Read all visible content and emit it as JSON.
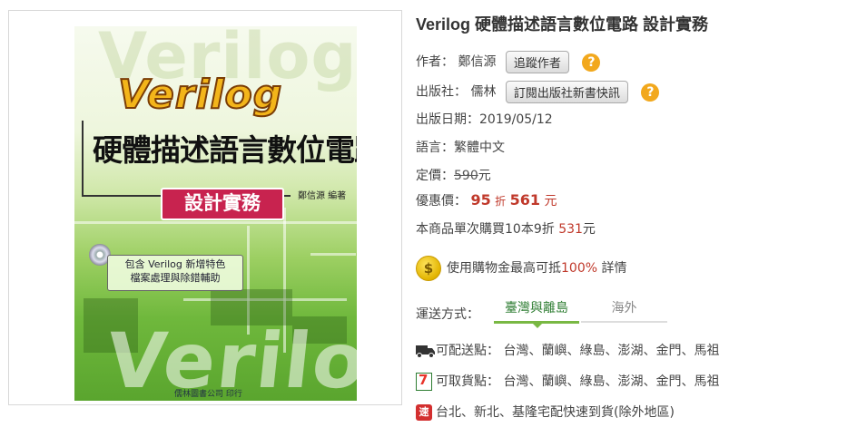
{
  "cover": {
    "ghost_top": "Verilog",
    "verilog": "Verilog",
    "title": "硬體描述語言數位電路",
    "subtitle": "設計實務",
    "author": "鄭信源 編著",
    "cd_line1": "包含 Verilog 新增特色",
    "cd_line2": "檔案處理與除錯輔助",
    "ghost_bottom": "Verilog",
    "publisher": "儒林圖書公司 印行"
  },
  "book": {
    "title": "Verilog 硬體描述語言數位電路 設計實務",
    "author_label": "作者：",
    "author": "鄭信源",
    "follow_author_button": "追蹤作者",
    "publisher_label": "出版社：",
    "publisher": "儒林",
    "subscribe_button": "訂閱出版社新書快訊",
    "date_label": "出版日期：",
    "date": "2019/05/12",
    "language_label": "語言：",
    "language": "繁體中文",
    "list_price_label": "定價：",
    "list_price": "590",
    "currency": "元",
    "sale_label": "優惠價：",
    "discount": "95",
    "discount_unit": "折",
    "sale_price": "561",
    "bulk_prefix": "本商品單次購買10本9折",
    "bulk_price": "531",
    "points_text": "使用購物金最高可抵",
    "points_percent": "100%",
    "points_details": "詳情"
  },
  "shipping": {
    "label": "運送方式：",
    "tabs": [
      "臺灣與離島",
      "海外"
    ],
    "delivery_label": "可配送點：",
    "delivery_places": "台灣、蘭嶼、綠島、澎湖、金門、馬祖",
    "pickup_label": "可取貨點：",
    "pickup_places": "台灣、蘭嶼、綠島、澎湖、金門、馬祖",
    "express_icon_text": "速",
    "express_text": "台北、新北、基隆宅配快速到貨(除外地區)"
  },
  "icons": {
    "help": "help-icon",
    "coin": "coin-icon",
    "truck": "truck-icon",
    "seven_eleven": "seven-eleven-icon",
    "express": "express-icon"
  },
  "colors": {
    "accent_green": "#79b843",
    "price_red": "#c0392b",
    "help_orange": "#f2a81d"
  }
}
